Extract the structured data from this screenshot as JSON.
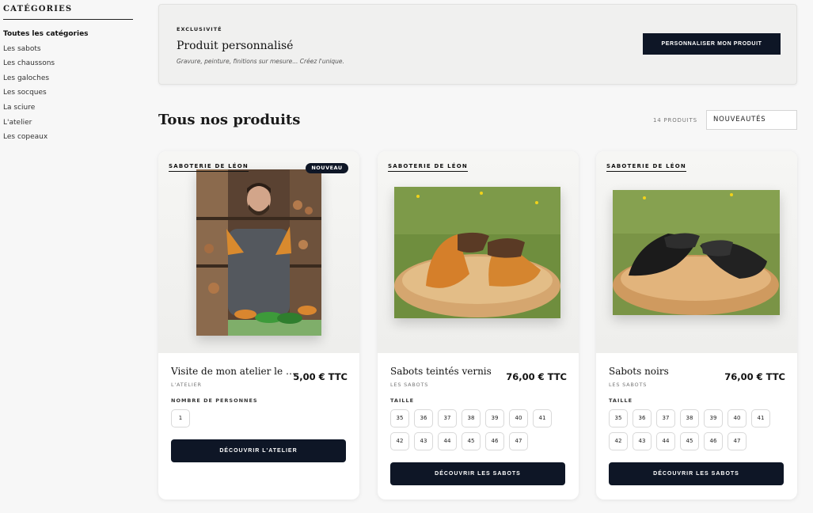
{
  "sidebar": {
    "title": "CATÉGORIES",
    "items": [
      {
        "label": "Toutes les catégories",
        "active": true
      },
      {
        "label": "Les sabots"
      },
      {
        "label": "Les chaussons"
      },
      {
        "label": "Les galoches"
      },
      {
        "label": "Les socques"
      },
      {
        "label": "La sciure"
      },
      {
        "label": "L'atelier"
      },
      {
        "label": "Les copeaux"
      }
    ]
  },
  "banner": {
    "kicker": "EXCLUSIVITÉ",
    "title": "Produit personnalisé",
    "subtitle": "Gravure, peinture, finitions sur mesure... Créez l'unique.",
    "button": "PERSONNALISER MON PRODUIT"
  },
  "products_header": {
    "title": "Tous nos produits",
    "count": "14 PRODUITS",
    "sort": "NOUVEAUTÉS"
  },
  "products": [
    {
      "brand": "SABOTERIE DE LÉON",
      "badge": "NOUVEAU",
      "name": "Visite de mon atelier le ma…",
      "category": "L'ATELIER",
      "price": "5,00 € TTC",
      "option_label": "NOMBRE DE PERSONNES",
      "options": [
        "1"
      ],
      "cta": "DÉCOUVRIR L'ATELIER"
    },
    {
      "brand": "SABOTERIE DE LÉON",
      "name": "Sabots teintés vernis",
      "category": "LES SABOTS",
      "price": "76,00 € TTC",
      "option_label": "TAILLE",
      "options": [
        "35",
        "36",
        "37",
        "38",
        "39",
        "40",
        "41",
        "42",
        "43",
        "44",
        "45",
        "46",
        "47"
      ],
      "cta": "DÉCOUVRIR LES SABOTS"
    },
    {
      "brand": "SABOTERIE DE LÉON",
      "name": "Sabots noirs",
      "category": "LES SABOTS",
      "price": "76,00 € TTC",
      "option_label": "TAILLE",
      "options": [
        "35",
        "36",
        "37",
        "38",
        "39",
        "40",
        "41",
        "42",
        "43",
        "44",
        "45",
        "46",
        "47"
      ],
      "cta": "DÉCOUVRIR LES SABOTS"
    }
  ],
  "colors": {
    "dark_navy": "#0e1626",
    "page_bg": "#f7f7f7",
    "card_bg": "#ffffff"
  }
}
